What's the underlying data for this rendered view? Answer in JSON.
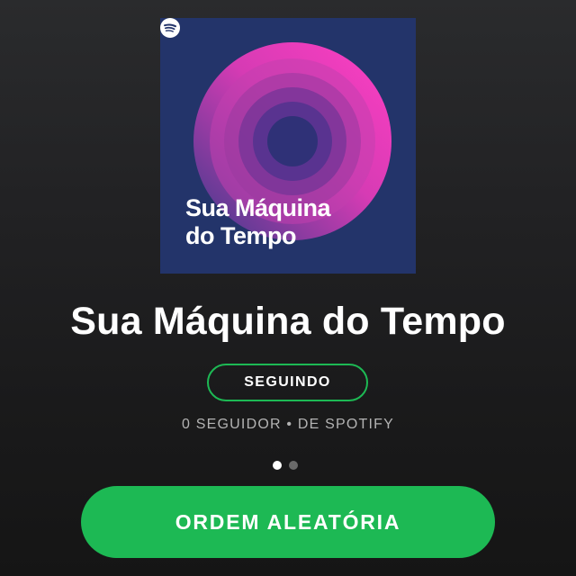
{
  "playlist": {
    "cover_title_line1": "Sua Máquina",
    "cover_title_line2": "do Tempo",
    "title": "Sua Máquina do Tempo",
    "follow_label": "SEGUINDO",
    "meta": "0 SEGUIDOR • DE SPOTIFY",
    "shuffle_label": "ORDEM ALEATÓRIA"
  },
  "pager": {
    "count": 2,
    "active_index": 0
  },
  "icons": {
    "cover_logo": "spotify-logo-icon"
  },
  "colors": {
    "accent": "#1db954",
    "cover_background": "#23346a",
    "cover_ring": "#f03ab8"
  }
}
